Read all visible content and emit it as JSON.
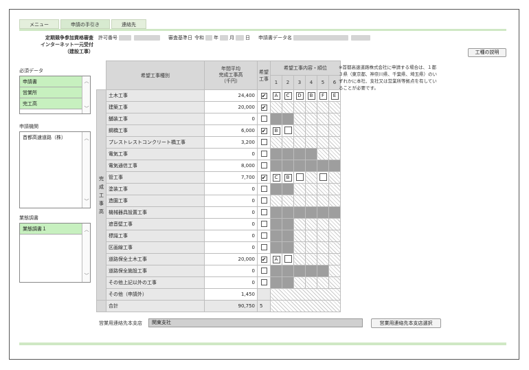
{
  "tabs": [
    "メニュー",
    "申請の手引き",
    "連絡先"
  ],
  "header": {
    "title_lines": [
      "定期競争参加資格審査",
      "インターネット一元受付",
      "（建設工事）"
    ],
    "permit_label": "許可番号",
    "review_date_label": "審査基準日",
    "era": "令和",
    "year_unit": "年",
    "month_unit": "月",
    "day_unit": "日",
    "applicant_label": "申請書データ名",
    "explain_button": "工種の説明"
  },
  "sidebar": {
    "required_label": "必須データ",
    "required_items": [
      "申請書",
      "営業所",
      "完工高"
    ],
    "agency_label": "申請機関",
    "agency_items": [
      "首都高速道路（株）"
    ],
    "survey_label": "業態調書",
    "survey_items": [
      "業態調書１"
    ]
  },
  "note": "※首都高速道路株式会社に申請する場合は、１都３県（東京都、神奈川県、千葉県、埼玉県）のいずれかに本社、支社又は営業所等拠点を有していることが必要です。",
  "table": {
    "col_type": "希望工事種別",
    "col_avg_lines": [
      "年間平均",
      "完成工事高",
      "（千円）"
    ],
    "col_hope_lines": [
      "希望",
      "工事"
    ],
    "col_rank_group": "希望工事内容・順位",
    "rank_cols": [
      "1",
      "2",
      "3",
      "4",
      "5",
      "6"
    ],
    "side_label": [
      "完",
      "成",
      "工",
      "事",
      "高"
    ],
    "rows": [
      {
        "name": "土木工事",
        "value": "24,400",
        "checked": "✔",
        "ranks": [
          "A",
          "C",
          "D",
          "B",
          "F",
          "E"
        ],
        "kinds": [
          "L",
          "L",
          "L",
          "L",
          "L",
          "L"
        ]
      },
      {
        "name": "建築工事",
        "value": "20,000",
        "checked": "✔",
        "ranks": [
          "",
          "",
          "",
          "",
          "",
          ""
        ],
        "kinds": [
          "h",
          "h",
          "h",
          "h",
          "h",
          "h"
        ]
      },
      {
        "name": "舗装工事",
        "value": "0",
        "checked": "",
        "ranks": [
          "",
          "",
          "",
          "",
          "",
          ""
        ],
        "kinds": [
          "d",
          "d",
          "h",
          "h",
          "h",
          "h"
        ]
      },
      {
        "name": "鋼橋工事",
        "value": "6,000",
        "checked": "✔",
        "ranks": [
          "B",
          "",
          "",
          "",
          "",
          ""
        ],
        "kinds": [
          "L",
          "W",
          "h",
          "h",
          "h",
          "h"
        ]
      },
      {
        "name": "プレストレストコンクリート橋工事",
        "value": "3,200",
        "checked": "",
        "ranks": [
          "",
          "",
          "",
          "",
          "",
          ""
        ],
        "kinds": [
          "h",
          "h",
          "h",
          "h",
          "h",
          "h"
        ]
      },
      {
        "name": "電気工事",
        "value": "0",
        "checked": "",
        "ranks": [
          "",
          "",
          "",
          "",
          "",
          ""
        ],
        "kinds": [
          "d",
          "d",
          "d",
          "d",
          "h",
          "h"
        ]
      },
      {
        "name": "電気通信工事",
        "value": "8,000",
        "checked": "",
        "ranks": [
          "",
          "",
          "",
          "",
          "",
          ""
        ],
        "kinds": [
          "d",
          "d",
          "d",
          "d",
          "d",
          "d"
        ]
      },
      {
        "name": "管工事",
        "value": "7,700",
        "checked": "✔",
        "ranks": [
          "C",
          "B",
          "",
          "",
          "",
          ""
        ],
        "kinds": [
          "L",
          "L",
          "W",
          "h",
          "W",
          "h"
        ]
      },
      {
        "name": "塗装工事",
        "value": "0",
        "checked": "",
        "ranks": [
          "",
          "",
          "",
          "",
          "",
          ""
        ],
        "kinds": [
          "d",
          "d",
          "h",
          "h",
          "h",
          "h"
        ]
      },
      {
        "name": "造園工事",
        "value": "0",
        "checked": "",
        "ranks": [
          "",
          "",
          "",
          "",
          "",
          ""
        ],
        "kinds": [
          "h",
          "h",
          "h",
          "h",
          "h",
          "h"
        ]
      },
      {
        "name": "機械器具設置工事",
        "value": "0",
        "checked": "",
        "ranks": [
          "",
          "",
          "",
          "",
          "",
          ""
        ],
        "kinds": [
          "d",
          "d",
          "d",
          "d",
          "d",
          "d"
        ]
      },
      {
        "name": "遮音壁工事",
        "value": "0",
        "checked": "",
        "ranks": [
          "",
          "",
          "",
          "",
          "",
          ""
        ],
        "kinds": [
          "d",
          "d",
          "h",
          "h",
          "h",
          "h"
        ]
      },
      {
        "name": "標識工事",
        "value": "0",
        "checked": "",
        "ranks": [
          "",
          "",
          "",
          "",
          "",
          ""
        ],
        "kinds": [
          "d",
          "d",
          "h",
          "h",
          "h",
          "h"
        ]
      },
      {
        "name": "区画線工事",
        "value": "0",
        "checked": "",
        "ranks": [
          "",
          "",
          "",
          "",
          "",
          ""
        ],
        "kinds": [
          "d",
          "d",
          "h",
          "h",
          "h",
          "h"
        ]
      },
      {
        "name": "道路保全土木工事",
        "value": "20,000",
        "checked": "✔",
        "ranks": [
          "A",
          "",
          "",
          "",
          "",
          ""
        ],
        "kinds": [
          "L",
          "W",
          "h",
          "h",
          "h",
          "h"
        ]
      },
      {
        "name": "道路保全施設工事",
        "value": "0",
        "checked": "",
        "ranks": [
          "",
          "",
          "",
          "",
          "",
          ""
        ],
        "kinds": [
          "d",
          "d",
          "d",
          "d",
          "d",
          "h"
        ]
      },
      {
        "name": "その他上記以外の工事",
        "value": "0",
        "checked": "",
        "ranks": [
          "",
          "",
          "",
          "",
          "",
          ""
        ],
        "kinds": [
          "d",
          "d",
          "h",
          "h",
          "h",
          "h"
        ]
      }
    ],
    "other_row": {
      "name": "その他（申請外）",
      "value": "1,450"
    },
    "total_row": {
      "name": "合計",
      "value": "90,750",
      "count": "5"
    }
  },
  "footer": {
    "branch_label": "営業用連絡先本支店",
    "branch_value": "関東支社",
    "branch_button": "営業用連絡先本支店選択"
  }
}
